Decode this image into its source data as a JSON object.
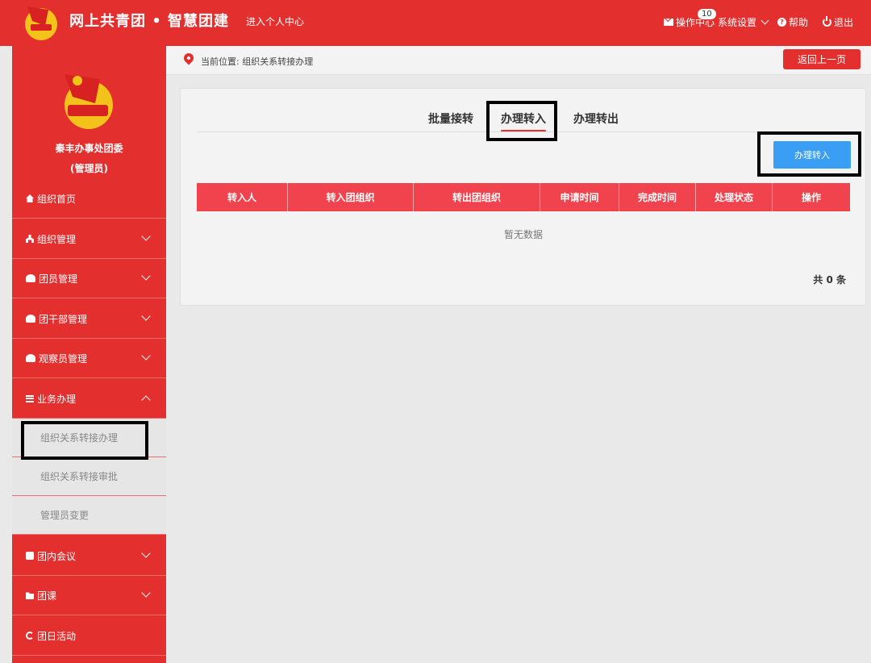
{
  "header": {
    "brand": "网上共青团 • 智慧团建",
    "enter_center": "进入个人中心",
    "ops_center": "操作中心",
    "ops_badge": "10",
    "system_settings": "系统设置",
    "help": "帮助",
    "logout": "退出"
  },
  "sidebar": {
    "org_name": "秦丰办事处团委",
    "role": "(管理员)",
    "items": [
      {
        "label": "组织首页",
        "icon": "home-icon"
      },
      {
        "label": "组织管理",
        "icon": "sitemap-icon"
      },
      {
        "label": "团员管理",
        "icon": "users-icon"
      },
      {
        "label": "团干部管理",
        "icon": "users-icon"
      },
      {
        "label": "观察员管理",
        "icon": "users-icon"
      },
      {
        "label": "业务办理",
        "icon": "list-icon"
      },
      {
        "label": "团内会议",
        "icon": "edit-icon"
      },
      {
        "label": "团课",
        "icon": "folder-icon"
      },
      {
        "label": "团日活动",
        "icon": "refresh-icon"
      }
    ],
    "sub_items": [
      {
        "label": "组织关系转接办理"
      },
      {
        "label": "组织关系转接审批"
      },
      {
        "label": "管理员变更"
      }
    ]
  },
  "breadcrumb": {
    "text": "当前位置: 组织关系转接办理",
    "back_label": "返回上一页"
  },
  "tabs": [
    {
      "label": "批量接转"
    },
    {
      "label": "办理转入"
    },
    {
      "label": "办理转出"
    }
  ],
  "action_button": "办理转入",
  "table": {
    "columns": [
      "转入人",
      "转入团组织",
      "转出团组织",
      "申请时间",
      "完成时间",
      "处理状态",
      "操作"
    ],
    "empty_text": "暂无数据",
    "total_text": "共 0 条"
  },
  "colors": {
    "primary_red": "#e42f2f",
    "table_header": "#f0434d",
    "action_blue": "#3b9ef5"
  }
}
